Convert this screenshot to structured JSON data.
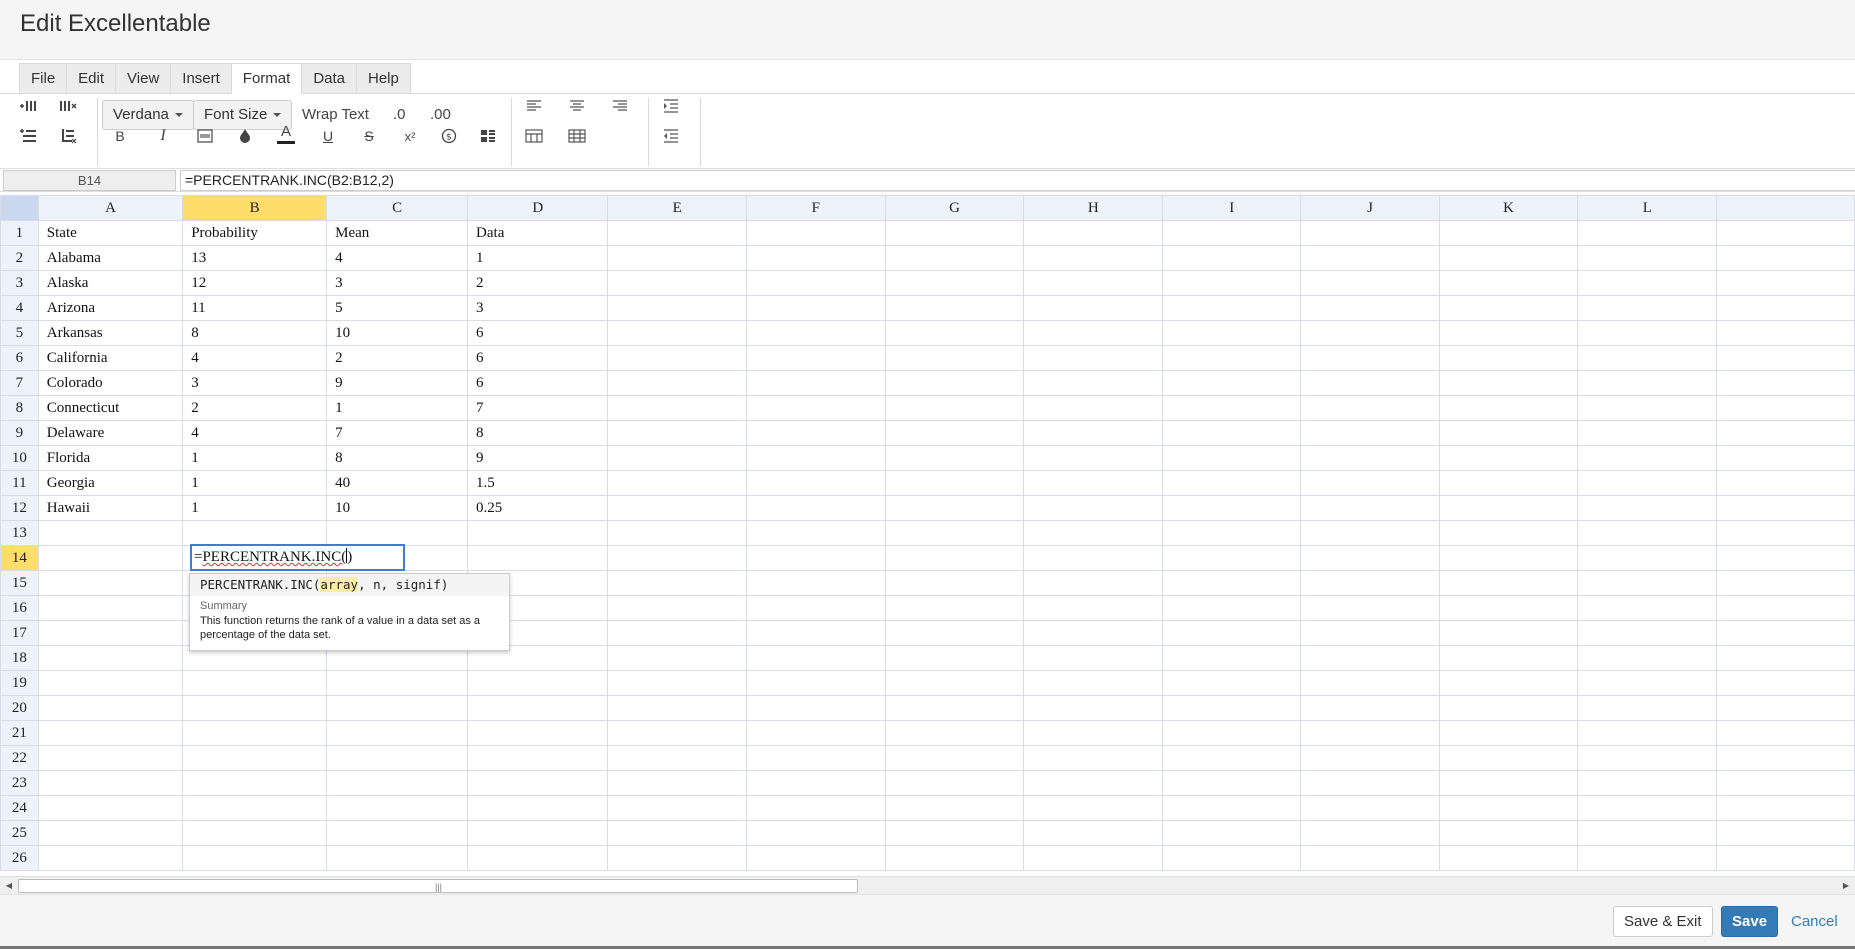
{
  "dialog": {
    "title": "Edit Excellentable"
  },
  "menu": {
    "tabs": [
      "File",
      "Edit",
      "View",
      "Insert",
      "Format",
      "Data",
      "Help"
    ],
    "active": "Format"
  },
  "toolbar": {
    "font_family": "Verdana",
    "font_size": "Font Size",
    "wrap_text": "Wrap Text",
    "decrease_decimal": ".0",
    "increase_decimal": ".00",
    "bold": "B",
    "italic": "I",
    "font_color": "A",
    "underline": "U",
    "strikethrough": "S",
    "superscript": "x²"
  },
  "formula_bar": {
    "cell_ref": "B14",
    "formula": "=PERCENTRANK.INC(B2:B12,2)"
  },
  "sheet": {
    "columns": [
      "A",
      "B",
      "C",
      "D",
      "E",
      "F",
      "G",
      "H",
      "I",
      "J",
      "K",
      "L"
    ],
    "selected_column": "B",
    "selected_row": "14",
    "rows": [
      {
        "num": "1",
        "cells": [
          "State",
          "Probability",
          "Mean",
          "Data"
        ]
      },
      {
        "num": "2",
        "cells": [
          "Alabama",
          "13",
          "4",
          "1"
        ]
      },
      {
        "num": "3",
        "cells": [
          "Alaska",
          "12",
          "3",
          "2"
        ]
      },
      {
        "num": "4",
        "cells": [
          "Arizona",
          "11",
          "5",
          "3"
        ]
      },
      {
        "num": "5",
        "cells": [
          "Arkansas",
          "8",
          "10",
          "6"
        ]
      },
      {
        "num": "6",
        "cells": [
          "California",
          "4",
          "2",
          "6"
        ]
      },
      {
        "num": "7",
        "cells": [
          "Colorado",
          "3",
          "9",
          "6"
        ]
      },
      {
        "num": "8",
        "cells": [
          "Connecticut",
          "2",
          "1",
          "7"
        ]
      },
      {
        "num": "9",
        "cells": [
          "Delaware",
          "4",
          "7",
          "8"
        ]
      },
      {
        "num": "10",
        "cells": [
          "Florida",
          "1",
          "8",
          "9"
        ]
      },
      {
        "num": "11",
        "cells": [
          "Georgia",
          "1",
          "40",
          "1.5"
        ]
      },
      {
        "num": "12",
        "cells": [
          "Hawaii",
          "1",
          "10",
          "0.25"
        ]
      },
      {
        "num": "13",
        "cells": []
      },
      {
        "num": "14",
        "cells": []
      },
      {
        "num": "15",
        "cells": []
      },
      {
        "num": "16",
        "cells": []
      },
      {
        "num": "17",
        "cells": []
      },
      {
        "num": "18",
        "cells": []
      },
      {
        "num": "19",
        "cells": []
      },
      {
        "num": "20",
        "cells": []
      },
      {
        "num": "21",
        "cells": []
      },
      {
        "num": "22",
        "cells": []
      },
      {
        "num": "23",
        "cells": []
      },
      {
        "num": "24",
        "cells": []
      },
      {
        "num": "25",
        "cells": []
      },
      {
        "num": "26",
        "cells": []
      }
    ]
  },
  "editor": {
    "prefix": "=",
    "function_text": "PERCENTRANK.INC(",
    "suffix": ")"
  },
  "tooltip": {
    "fn_name": "PERCENTRANK.INC(",
    "arg_highlight": "array",
    "arg_rest": ", n, signif)",
    "summary_label": "Summary",
    "description": "This function returns the rank of a value in a data set as a percentage of the data set."
  },
  "footer": {
    "save_exit": "Save & Exit",
    "save": "Save",
    "cancel": "Cancel"
  },
  "colors": {
    "primary": "#337ab7",
    "selected_header": "#ffdd6b",
    "editor_border": "#3b7dd8"
  }
}
